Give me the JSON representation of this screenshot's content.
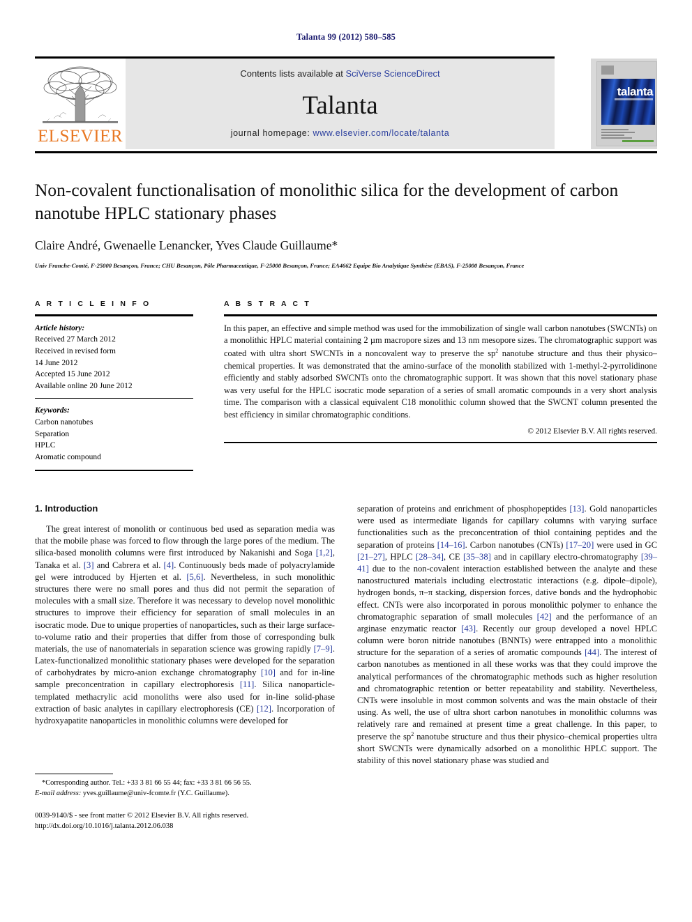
{
  "running_head": "Talanta 99 (2012) 580–585",
  "masthead": {
    "contents_prefix": "Contents lists available at ",
    "sciencedirect": "SciVerse ScienceDirect",
    "journal_title": "Talanta",
    "homepage_prefix": "journal homepage: ",
    "homepage_url": "www.elsevier.com/locate/talanta",
    "publisher": "ELSEVIER",
    "cover_label": "talanta",
    "link_color": "#2b3f9e",
    "publisher_color": "#e87722",
    "band_color": "#e6e6e6"
  },
  "article": {
    "title": "Non-covalent functionalisation of monolithic silica for the development of carbon nanotube HPLC stationary phases",
    "authors": "Claire André, Gwenaelle Lenancker, Yves Claude Guillaume*",
    "affiliation": "Univ Franche-Comté, F-25000 Besançon, France; CHU Besançon, Pôle Pharmaceutique, F-25000 Besançon, France; EA4662 Equipe Bio Analytique Synthèse (EBAS), F-25000 Besançon, France"
  },
  "article_info": {
    "heading": "A R T I C L E   I N F O",
    "history_label": "Article history:",
    "history": [
      "Received 27 March 2012",
      "Received in revised form",
      "14 June 2012",
      "Accepted 15 June 2012",
      "Available online 20 June 2012"
    ],
    "keywords_label": "Keywords:",
    "keywords": [
      "Carbon nanotubes",
      "Separation",
      "HPLC",
      "Aromatic compound"
    ]
  },
  "abstract": {
    "heading": "A B S T R A C T",
    "part1": "In this paper, an effective and simple method was used for the immobilization of single wall carbon nanotubes (SWCNTs) on a monolithic HPLC material containing 2 µm macropore sizes and 13 nm mesopore sizes. The chromatographic support was coated with ultra short SWCNTs in a noncovalent way to preserve the sp",
    "sup": "2",
    "part2": " nanotube structure and thus their physico–chemical properties. It was demonstrated that the amino-surface of the monolith stabilized with 1-methyl-2-pyrrolidinone efficiently and stably adsorbed SWCNTs onto the chromatographic support. It was shown that this novel stationary phase was very useful for the HPLC isocratic mode separation of a series of small aromatic compounds in a very short analysis time. The comparison with a classical equivalent C18 monolithic column showed that the SWCNT column presented the best efficiency in similar chromatographic conditions.",
    "copyright": "© 2012 Elsevier B.V. All rights reserved."
  },
  "body": {
    "section_heading": "1.  Introduction",
    "left_p1_a": "The great interest of monolith or continuous bed used as separation media was that the mobile phase was forced to flow through the large pores of the medium. The silica-based monolith columns were first introduced by Nakanishi and Soga ",
    "left_ref1": "[1,2]",
    "left_p1_b": ", Tanaka et al. ",
    "left_ref2": "[3]",
    "left_p1_c": " and Cabrera et al. ",
    "left_ref3": "[4]",
    "left_p1_d": ". Continuously beds made of polyacrylamide gel were introduced by Hjerten et al. ",
    "left_ref4": "[5,6]",
    "left_p1_e": ". Nevertheless, in such monolithic structures there were no small pores and thus did not permit the separation of molecules with a small size. Therefore it was necessary to develop novel monolithic structures to improve their efficiency for separation of small molecules in an isocratic mode. Due to unique properties of nanoparticles, such as their large surface-to-volume ratio and their properties that differ from those of corresponding bulk materials, the use of nanomaterials in separation science was growing rapidly ",
    "left_ref5": "[7–9]",
    "left_p1_f": ". Latex-functionalized monolithic stationary phases were developed for the separation of carbohydrates by micro-anion exchange chromatography ",
    "left_ref6": "[10]",
    "left_p1_g": " and for in-line sample preconcentration in capillary electrophoresis ",
    "left_ref7": "[11]",
    "left_p1_h": ". Silica nanoparticle-templated methacrylic acid monoliths were also used for in-line solid-phase extraction of basic analytes in capillary electrophoresis (CE) ",
    "left_ref8": "[12]",
    "left_p1_i": ". Incorporation of hydroxyapatite nanoparticles in monolithic columns were developed for",
    "right_p1_a": "separation of proteins and enrichment of phosphopeptides ",
    "right_ref1": "[13]",
    "right_p1_b": ". Gold nanoparticles were used as intermediate ligands for capillary columns with varying surface functionalities such as the preconcentration of thiol containing peptides and the separation of proteins ",
    "right_ref2": "[14–16]",
    "right_p1_c": ". Carbon nanotubes (CNTs) ",
    "right_ref3": "[17–20]",
    "right_p1_d": " were used in GC ",
    "right_ref4": "[21–27]",
    "right_p1_e": ", HPLC ",
    "right_ref5": "[28–34]",
    "right_p1_f": ", CE ",
    "right_ref6": "[35–38]",
    "right_p1_g": " and in capillary electro-chromatography ",
    "right_ref7": "[39–41]",
    "right_p1_h": " due to the non-covalent interaction established between the analyte and these nanostructured materials including electrostatic interactions (e.g. dipole–dipole), hydrogen bonds, π–π stacking, dispersion forces, dative bonds and the hydrophobic effect. CNTs were also incorporated in porous monolithic polymer to enhance the chromatographic separation of small molecules ",
    "right_ref8": "[42]",
    "right_p1_i": " and the performance of an arginase enzymatic reactor ",
    "right_ref9": "[43]",
    "right_p1_j": ". Recently our group developed a novel HPLC column were boron nitride nanotubes (BNNTs) were entrapped into a monolithic structure for the separation of a series of aromatic compounds ",
    "right_ref10": "[44]",
    "right_p1_k": ". The interest of carbon nanotubes as mentioned in all these works was that they could improve the analytical performances of the chromatographic methods such as higher resolution and chromatographic retention or better repeatability and stability. Nevertheless, CNTs were insoluble in most common solvents and was the main obstacle of their using. As well, the use of ultra short carbon nanotubes in monolithic columns was relatively rare and remained at present time a great challenge. In this paper, to preserve the sp",
    "right_sup": "2",
    "right_p1_l": " nanotube structure and thus their physico–chemical properties ultra short SWCNTs were dynamically adsorbed on a monolithic HPLC support. The stability of this novel stationary phase was studied and"
  },
  "footnote": {
    "corresponding": "*Corresponding author. Tel.: +33 3 81 66 55 44; fax: +33 3 81 66 56 55.",
    "email_label": "E-mail address:",
    "email": " yves.guillaume@univ-fcomte.fr (Y.C. Guillaume).",
    "front_matter": "0039-9140/$ - see front matter © 2012 Elsevier B.V. All rights reserved.",
    "doi": "http://dx.doi.org/10.1016/j.talanta.2012.06.038"
  }
}
